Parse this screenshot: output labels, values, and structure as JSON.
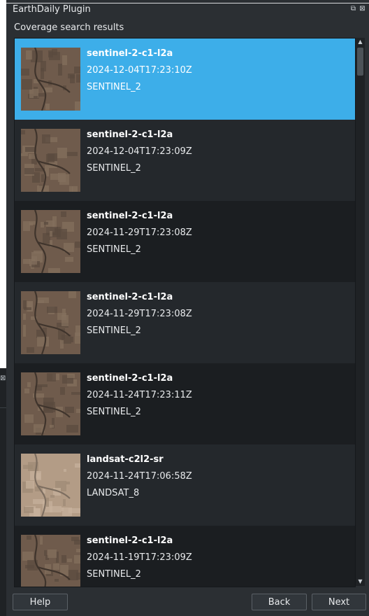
{
  "window": {
    "title": "EarthDaily Plugin",
    "float_icon": "float-icon",
    "close_icon": "close-icon"
  },
  "results": {
    "label": "Coverage search results",
    "items": [
      {
        "collection": "sentinel-2-c1-l2a",
        "datetime": "2024-12-04T17:23:10Z",
        "platform": "SENTINEL_2",
        "selected": true
      },
      {
        "collection": "sentinel-2-c1-l2a",
        "datetime": "2024-12-04T17:23:09Z",
        "platform": "SENTINEL_2",
        "selected": false
      },
      {
        "collection": "sentinel-2-c1-l2a",
        "datetime": "2024-11-29T17:23:08Z",
        "platform": "SENTINEL_2",
        "selected": false
      },
      {
        "collection": "sentinel-2-c1-l2a",
        "datetime": "2024-11-29T17:23:08Z",
        "platform": "SENTINEL_2",
        "selected": false
      },
      {
        "collection": "sentinel-2-c1-l2a",
        "datetime": "2024-11-24T17:23:11Z",
        "platform": "SENTINEL_2",
        "selected": false
      },
      {
        "collection": "landsat-c2l2-sr",
        "datetime": "2024-11-24T17:06:58Z",
        "platform": "LANDSAT_8",
        "selected": false
      },
      {
        "collection": "sentinel-2-c1-l2a",
        "datetime": "2024-11-19T17:23:09Z",
        "platform": "SENTINEL_2",
        "selected": false
      }
    ]
  },
  "buttons": {
    "help": "Help",
    "back": "Back",
    "next": "Next"
  },
  "colors": {
    "selection": "#3daee9",
    "panel_background": "#2b2f33"
  }
}
